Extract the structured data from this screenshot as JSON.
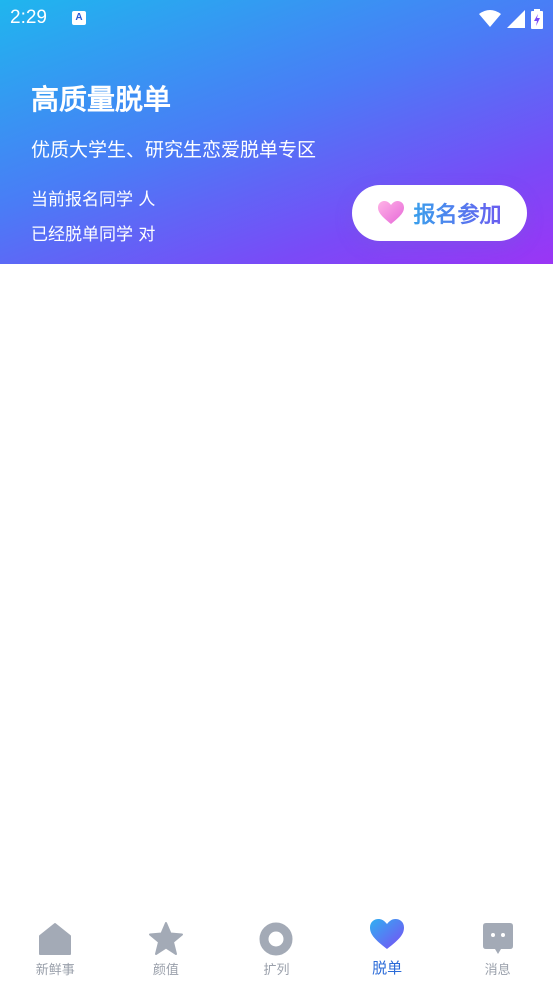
{
  "status_bar": {
    "time": "2:29",
    "app_icon": "A"
  },
  "hero": {
    "title": "高质量脱单",
    "subtitle": "优质大学生、研究生恋爱脱单专区",
    "registered_text": "当前报名同学 人",
    "success_text": "已经脱单同学 对",
    "join_button_label": "报名参加",
    "gradient_colors": [
      "#1fb6ee",
      "#4a7cf6",
      "#7a4af7",
      "#9b35f5"
    ]
  },
  "tabbar": {
    "active_color": "#2b6bd8",
    "inactive_color": "#9aa0ab",
    "tabs": [
      {
        "label": "新鲜事",
        "icon": "home-icon",
        "active": false
      },
      {
        "label": "颜值",
        "icon": "star-icon",
        "active": false
      },
      {
        "label": "扩列",
        "icon": "ring-icon",
        "active": false
      },
      {
        "label": "脱单",
        "icon": "heart-icon",
        "active": true
      },
      {
        "label": "消息",
        "icon": "message-icon",
        "active": false
      }
    ]
  }
}
